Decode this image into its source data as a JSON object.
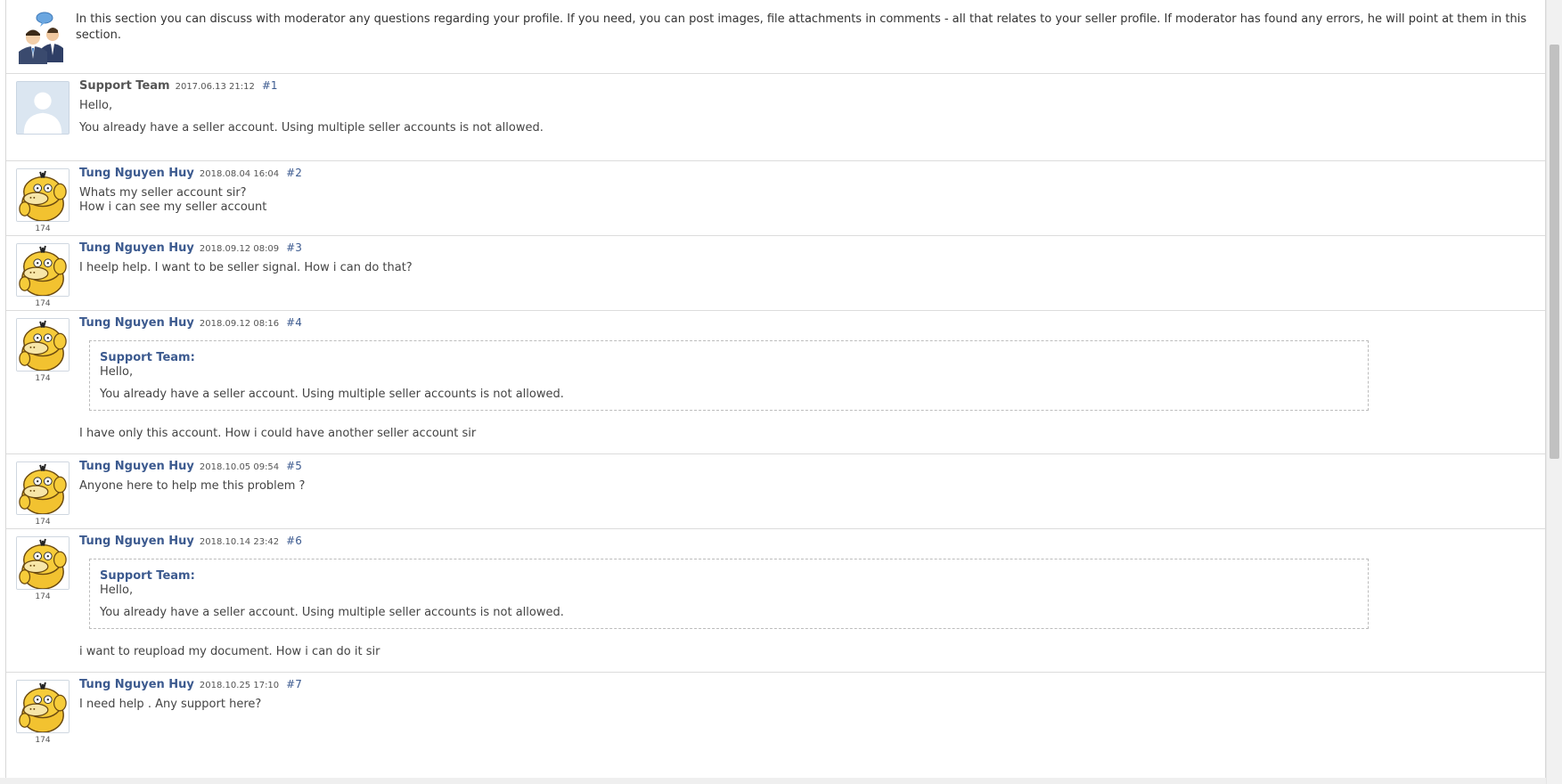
{
  "intro": {
    "text": "In this section you can discuss with moderator any questions regarding your profile. If you need, you can post images, file attachments in comments - all that relates to your seller profile. If moderator has found any errors, he will point at them in this section."
  },
  "posts": [
    {
      "author": "Support Team",
      "date": "2017.06.13 21:12",
      "num": "#1",
      "rating": "",
      "lines": [
        "Hello,",
        "You already have a seller account. Using multiple seller accounts is not allowed."
      ]
    },
    {
      "author": "Tung Nguyen Huy",
      "date": "2018.08.04 16:04",
      "num": "#2",
      "rating": "174",
      "lines": [
        "Whats my seller account sir?",
        "How i can see my seller account"
      ]
    },
    {
      "author": "Tung Nguyen Huy",
      "date": "2018.09.12 08:09",
      "num": "#3",
      "rating": "174",
      "lines": [
        "I heelp help. I want to be seller signal. How i can do that?"
      ]
    },
    {
      "author": "Tung Nguyen Huy",
      "date": "2018.09.12 08:16",
      "num": "#4",
      "rating": "174",
      "quote": {
        "name": "Support Team:",
        "line1": "Hello,",
        "line2": "You already have a seller account. Using multiple seller accounts is not allowed."
      },
      "lines": [
        "I have only this account. How i could have another seller account sir"
      ]
    },
    {
      "author": "Tung Nguyen Huy",
      "date": "2018.10.05 09:54",
      "num": "#5",
      "rating": "174",
      "lines": [
        "Anyone here to help me this problem ?"
      ]
    },
    {
      "author": "Tung Nguyen Huy",
      "date": "2018.10.14 23:42",
      "num": "#6",
      "rating": "174",
      "quote": {
        "name": "Support Team:",
        "line1": "Hello,",
        "line2": "You already have a seller account. Using multiple seller accounts is not allowed."
      },
      "lines": [
        "i want to reupload my document. How i can do it sir"
      ]
    },
    {
      "author": "Tung Nguyen Huy",
      "date": "2018.10.25 17:10",
      "num": "#7",
      "rating": "174",
      "lines": [
        "I need help . Any support here?"
      ]
    }
  ],
  "colors": {
    "author_link": "#3c5a8f",
    "staff_author": "#555555",
    "divider": "#dcdcdc"
  },
  "icons": {
    "intro": "discussion-people-icon",
    "staff_avatar": "default-user-avatar",
    "user_avatar": "yellow-duck-avatar"
  }
}
